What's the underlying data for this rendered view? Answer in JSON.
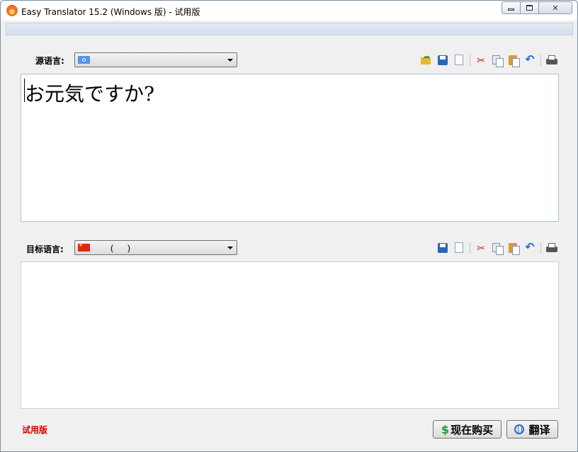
{
  "window": {
    "title": "Easy Translator 15.2 (Windows 版) - 试用版",
    "icon": "flame-app-icon",
    "controls": [
      "minimize-icon",
      "maximize-icon",
      "close-icon"
    ],
    "close_glyph": "✕"
  },
  "source": {
    "label": "源语言:",
    "language_value": "",
    "flag": "un-flag",
    "text": "お元気ですか?",
    "toolbar": [
      "open-icon",
      "save-icon",
      "new-icon",
      "cut-icon",
      "copy-icon",
      "paste-icon",
      "undo-icon",
      "print-icon"
    ]
  },
  "target": {
    "label": "目标语言:",
    "language_value": "(      )",
    "flag": "china-flag",
    "text": "",
    "toolbar": [
      "save-icon",
      "new-icon",
      "cut-icon",
      "copy-icon",
      "paste-icon",
      "undo-icon",
      "print-icon"
    ]
  },
  "footer": {
    "trial_label": "试用版",
    "buy_label": "现在购买",
    "translate_label": "翻译"
  },
  "colors": {
    "trial_text": "#d40000",
    "dollar_icon": "#1e9a3a",
    "globe_icon": "#2a6cc8"
  }
}
